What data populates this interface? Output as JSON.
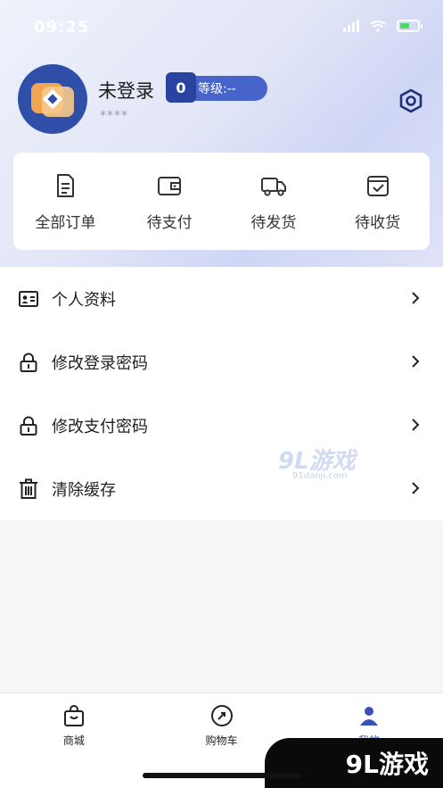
{
  "status_bar": {
    "time": "09:25"
  },
  "profile": {
    "name": "未登录",
    "masked": "****",
    "level_number": "0",
    "level_text": "等级:--"
  },
  "orders": [
    {
      "label": "全部订单",
      "icon": "order-list-icon"
    },
    {
      "label": "待支付",
      "icon": "wallet-icon"
    },
    {
      "label": "待发货",
      "icon": "truck-icon"
    },
    {
      "label": "待收货",
      "icon": "box-check-icon"
    }
  ],
  "menu": [
    {
      "label": "个人资料",
      "icon": "id-card-icon"
    },
    {
      "label": "修改登录密码",
      "icon": "lock-icon"
    },
    {
      "label": "修改支付密码",
      "icon": "lock-icon"
    },
    {
      "label": "清除缓存",
      "icon": "trash-icon"
    }
  ],
  "watermark": {
    "text": "9L游戏",
    "sub": "91danji.com"
  },
  "tabbar": [
    {
      "label": "商城",
      "icon": "shopping-bag-icon"
    },
    {
      "label": "购物车",
      "icon": "cart-icon"
    },
    {
      "label": "我的",
      "icon": "user-icon"
    }
  ],
  "corner_brand": "9L游戏",
  "colors": {
    "accent": "#3b4fb8",
    "badge": "#4664c9",
    "avatar": "#2f4fa8"
  }
}
